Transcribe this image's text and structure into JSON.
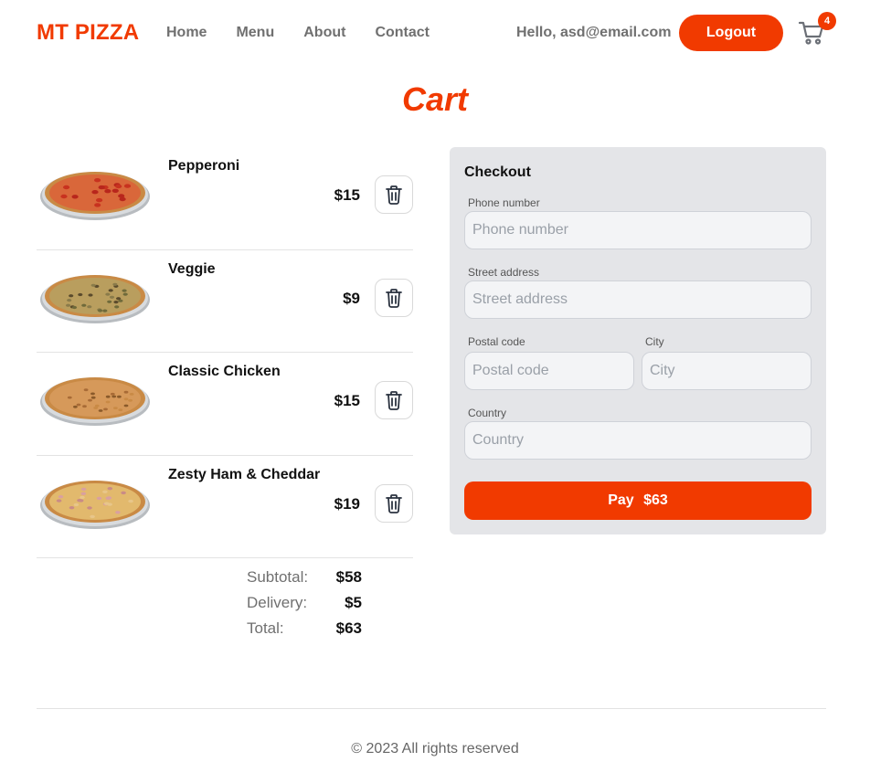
{
  "header": {
    "logo": "MT PIZZA",
    "nav": [
      "Home",
      "Menu",
      "About",
      "Contact"
    ],
    "greeting": "Hello, asd@email.com",
    "logout_label": "Logout",
    "cart_count": "4"
  },
  "page_title": "Cart",
  "cart": {
    "items": [
      {
        "name": "Pepperoni",
        "price": "$15",
        "style": "pepperoni"
      },
      {
        "name": "Veggie",
        "price": "$9",
        "style": "veggie"
      },
      {
        "name": "Classic Chicken",
        "price": "$15",
        "style": "chicken"
      },
      {
        "name": "Zesty Ham & Cheddar",
        "price": "$19",
        "style": "ham"
      }
    ],
    "totals": {
      "subtotal_label": "Subtotal:",
      "subtotal": "$58",
      "delivery_label": "Delivery:",
      "delivery": "$5",
      "total_label": "Total:",
      "total": "$63"
    }
  },
  "checkout": {
    "title": "Checkout",
    "phone": {
      "label": "Phone number",
      "placeholder": "Phone number",
      "value": ""
    },
    "street": {
      "label": "Street address",
      "placeholder": "Street address",
      "value": ""
    },
    "postal": {
      "label": "Postal code",
      "placeholder": "Postal code",
      "value": ""
    },
    "city": {
      "label": "City",
      "placeholder": "City",
      "value": ""
    },
    "country": {
      "label": "Country",
      "placeholder": "Country",
      "value": ""
    },
    "pay_label": "Pay",
    "pay_amount": "$63"
  },
  "footer": "© 2023 All rights reserved",
  "colors": {
    "accent": "#f13a00",
    "panel_bg": "#e4e5e8",
    "nav_text": "#707070"
  },
  "icons": {
    "cart": "shopping-cart-icon",
    "trash": "trash-icon"
  }
}
